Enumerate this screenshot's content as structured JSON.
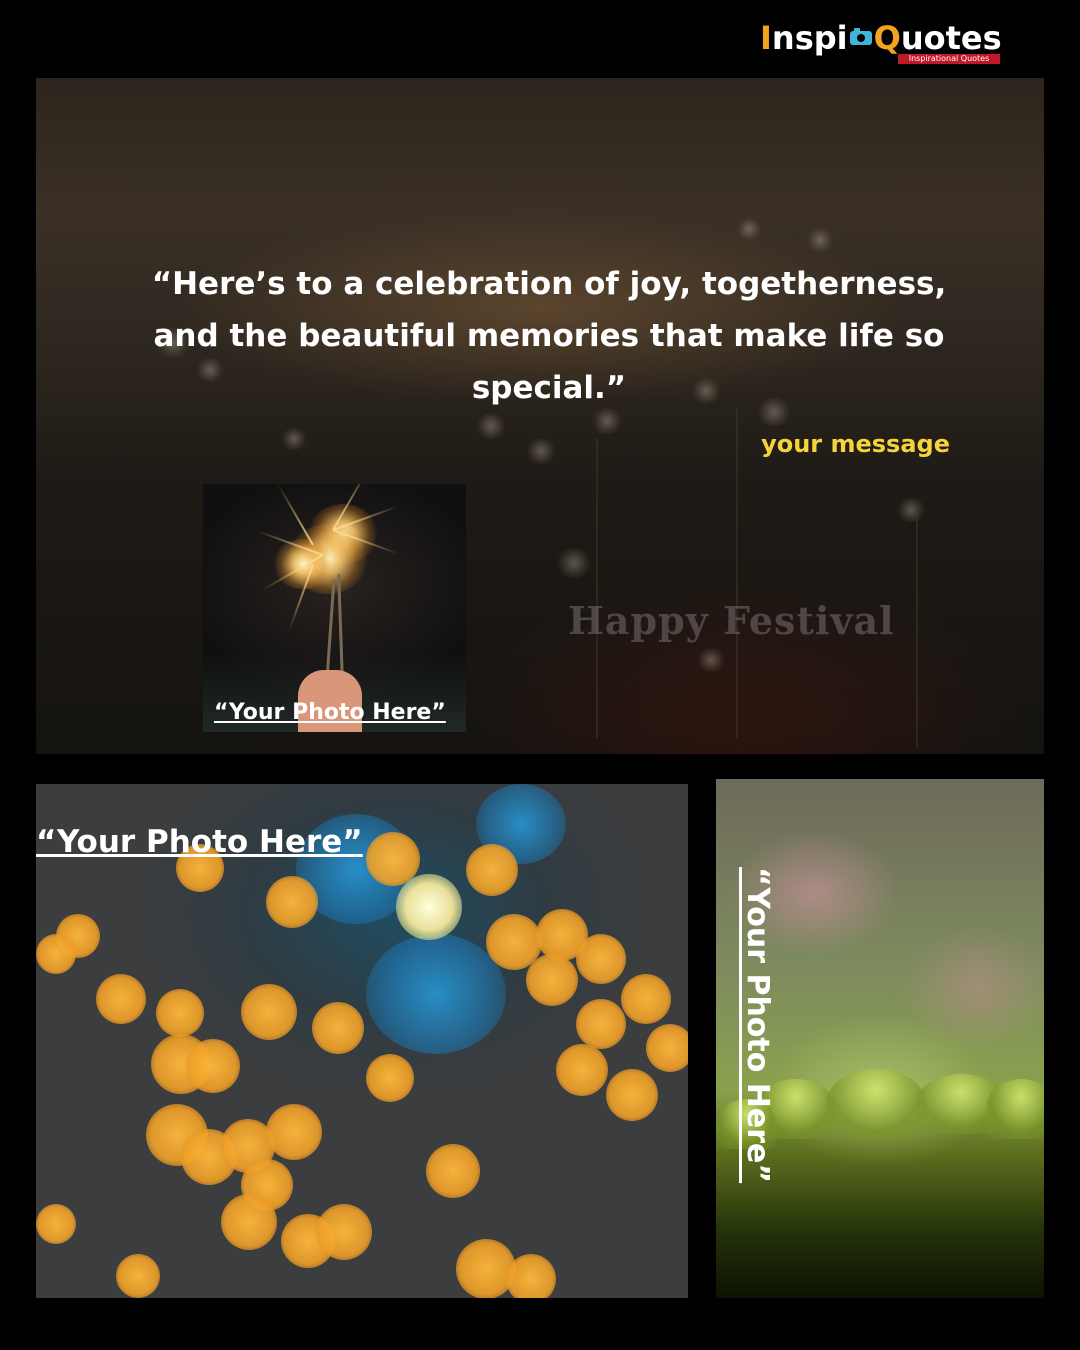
{
  "logo": {
    "part1": "Inspi",
    "part2": "Quotes",
    "tagline": "Inspirational Quotes",
    "camera_icon": "camera-icon",
    "colors": {
      "accent": "#f3a31c",
      "camera": "#3fb6d8",
      "bar": "#c0182a"
    }
  },
  "hero": {
    "quote": "“Here’s to a celebration of joy, togetherness, and the beautiful memories that make life so special.”",
    "message": "your message",
    "watermark": "Happy Festival",
    "photo_placeholder": "“Your Photo Here”",
    "colors": {
      "message": "#f5d33b"
    }
  },
  "bottom_left": {
    "photo_placeholder": "“Your Photo Here”"
  },
  "bottom_right": {
    "photo_placeholder": "“Your Photo Here”"
  }
}
